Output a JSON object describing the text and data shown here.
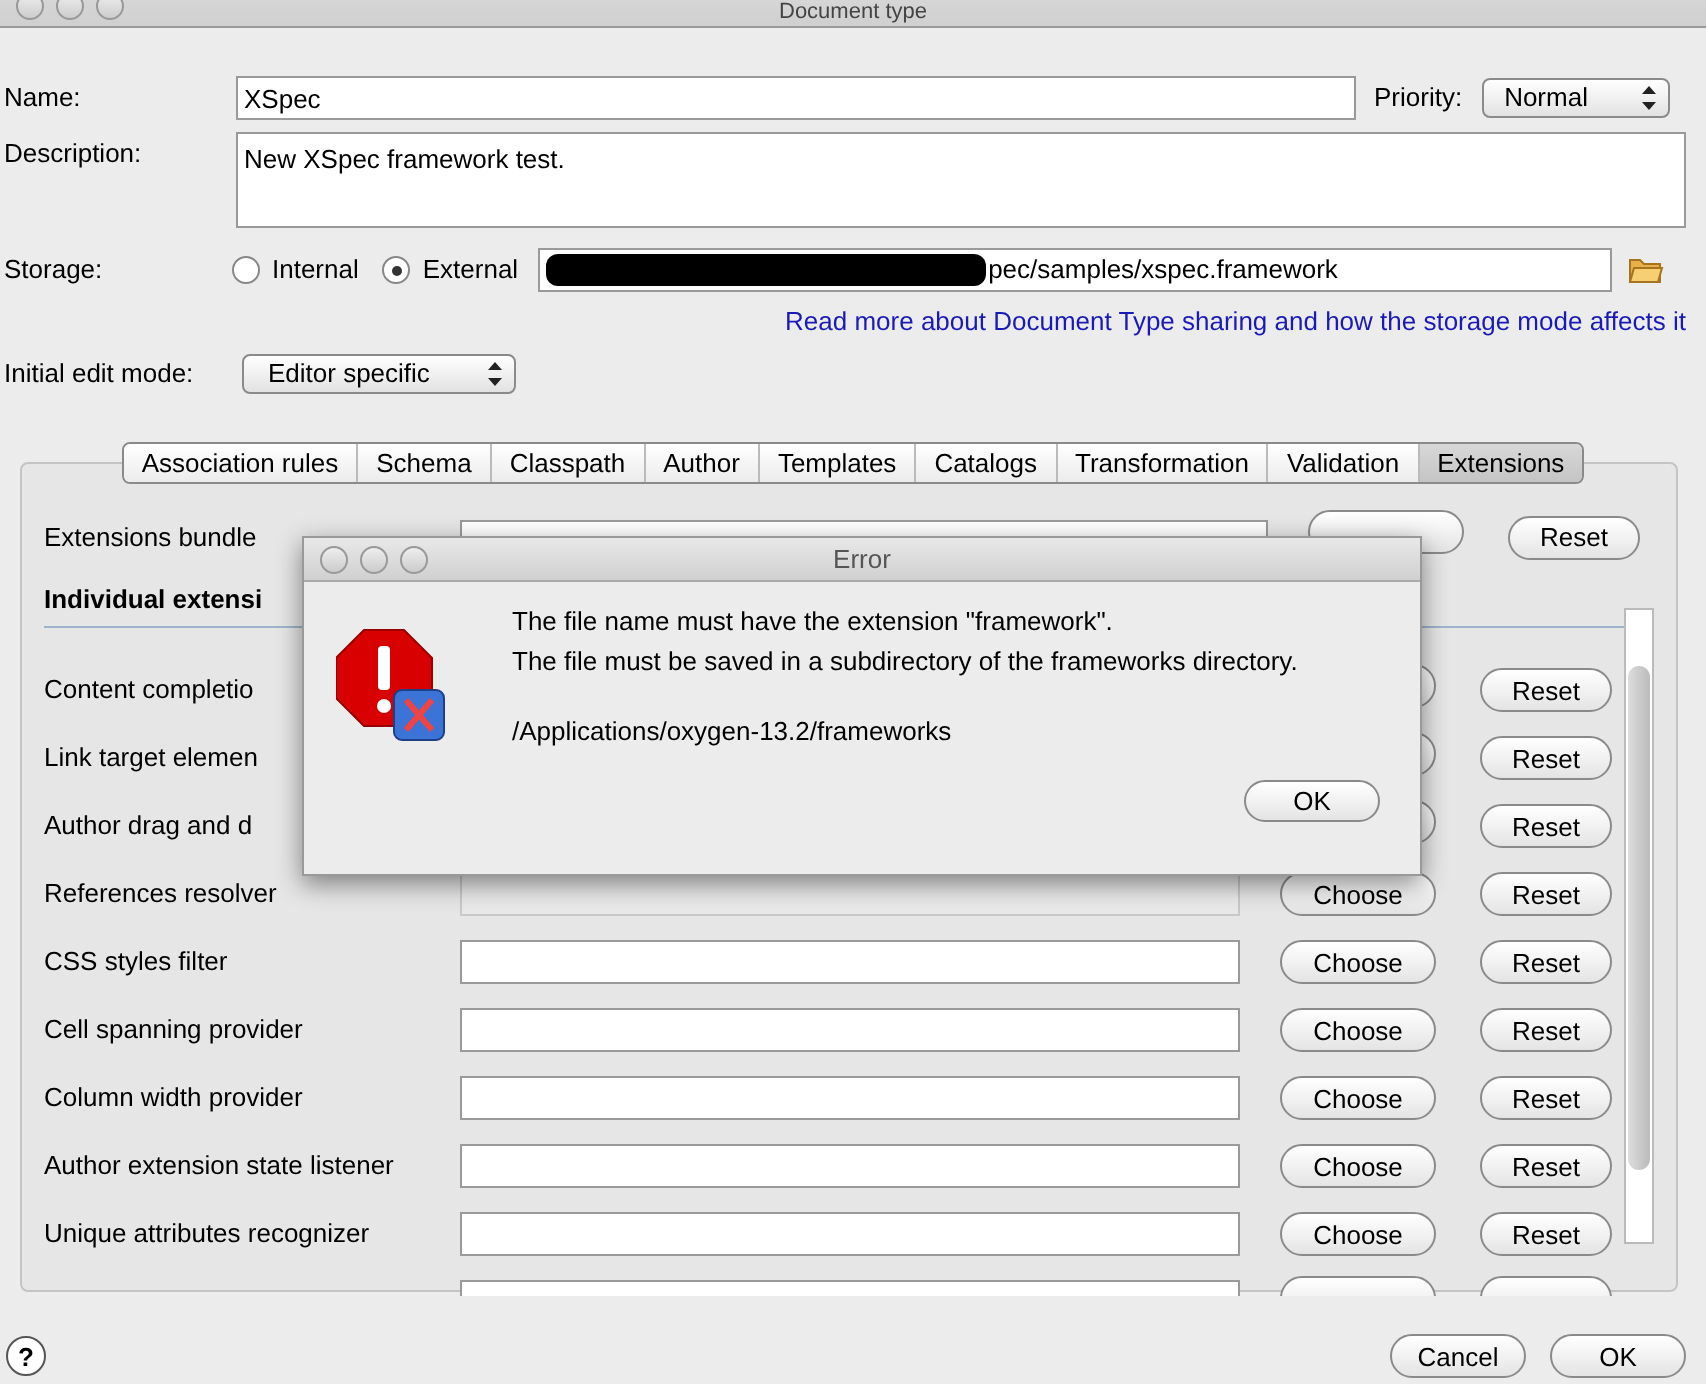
{
  "window": {
    "title": "Document type"
  },
  "name": {
    "label": "Name:",
    "value": "XSpec"
  },
  "priority": {
    "label": "Priority:",
    "value": "Normal"
  },
  "description": {
    "label": "Description:",
    "value": "New XSpec framework test."
  },
  "storage": {
    "label": "Storage:",
    "options": [
      {
        "label": "Internal",
        "selected": false
      },
      {
        "label": "External",
        "selected": true
      }
    ],
    "path": "pec/samples/xspec.framework"
  },
  "info_link": "Read more about Document Type sharing and how the storage mode affects it",
  "edit_mode": {
    "label": "Initial edit mode:",
    "value": "Editor specific"
  },
  "tabs": [
    {
      "label": "Association rules",
      "selected": false
    },
    {
      "label": "Schema",
      "selected": false
    },
    {
      "label": "Classpath",
      "selected": false
    },
    {
      "label": "Author",
      "selected": false
    },
    {
      "label": "Templates",
      "selected": false
    },
    {
      "label": "Catalogs",
      "selected": false
    },
    {
      "label": "Transformation",
      "selected": false
    },
    {
      "label": "Validation",
      "selected": false
    },
    {
      "label": "Extensions",
      "selected": true
    }
  ],
  "bundle": {
    "label": "Extensions bundle",
    "reset": "Reset"
  },
  "section_title": "Individual extensi",
  "rows": [
    {
      "label": "Content completio",
      "reset": "Reset"
    },
    {
      "label": "Link target elemen",
      "reset": "Reset"
    },
    {
      "label": "Author drag and d",
      "reset": "Reset"
    },
    {
      "label": "References resolver",
      "choose": "Choose",
      "reset": "Reset",
      "disabled": true
    },
    {
      "label": "CSS styles filter",
      "choose": "Choose",
      "reset": "Reset",
      "disabled": false
    },
    {
      "label": "Cell spanning provider",
      "choose": "Choose",
      "reset": "Reset",
      "disabled": false
    },
    {
      "label": "Column width provider",
      "choose": "Choose",
      "reset": "Reset",
      "disabled": false
    },
    {
      "label": "Author extension state listener",
      "choose": "Choose",
      "reset": "Reset",
      "disabled": false
    },
    {
      "label": "Unique attributes recognizer",
      "choose": "Choose",
      "reset": "Reset",
      "disabled": false
    },
    {
      "disabled": false
    }
  ],
  "footer": {
    "help": "?",
    "cancel": "Cancel",
    "ok": "OK"
  },
  "error_dialog": {
    "title": "Error",
    "lines": [
      "The file name must have the extension \"framework\".",
      "The file must be saved in a subdirectory of the frameworks directory."
    ],
    "path": "/Applications/oxygen-13.2/frameworks",
    "ok": "OK"
  }
}
